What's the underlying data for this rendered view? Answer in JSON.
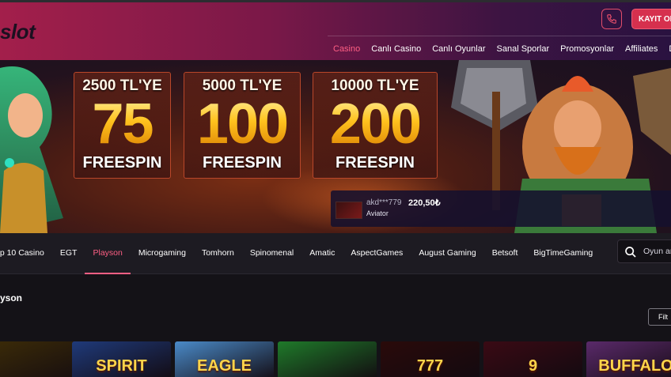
{
  "header": {
    "logo": "slot",
    "register_label": "KAYIT OL",
    "nav": [
      {
        "label": "Casino",
        "active": true
      },
      {
        "label": "Canlı Casino",
        "active": false
      },
      {
        "label": "Canlı Oyunlar",
        "active": false
      },
      {
        "label": "Sanal Sporlar",
        "active": false
      },
      {
        "label": "Promosyonlar",
        "active": false
      },
      {
        "label": "Affiliates",
        "active": false
      },
      {
        "label": "Discount",
        "active": false
      }
    ]
  },
  "banner": {
    "promos": [
      {
        "line1": "2500 TL'YE",
        "line2": "75",
        "line3": "FREESPIN"
      },
      {
        "line1": "5000 TL'YE",
        "line2": "100",
        "line3": "FREESPIN"
      },
      {
        "line1": "10000 TL'YE",
        "line2": "200",
        "line3": "FREESPIN"
      }
    ],
    "winner": {
      "user": "akd***779",
      "separator": "-",
      "amount": "220,50₺",
      "game": "Aviator"
    }
  },
  "providers": {
    "items": [
      {
        "label": "op 10 Casino",
        "active": false
      },
      {
        "label": "EGT",
        "active": false
      },
      {
        "label": "Playson",
        "active": true
      },
      {
        "label": "Microgaming",
        "active": false
      },
      {
        "label": "Tomhorn",
        "active": false
      },
      {
        "label": "Spinomenal",
        "active": false
      },
      {
        "label": "Amatic",
        "active": false
      },
      {
        "label": "AspectGames",
        "active": false
      },
      {
        "label": "August Gaming",
        "active": false
      },
      {
        "label": "Betsoft",
        "active": false
      },
      {
        "label": "BigTimeGaming",
        "active": false
      }
    ],
    "search_placeholder": "Oyun ar"
  },
  "section": {
    "title": "yson",
    "filter_label": "Filt"
  },
  "games": [
    {
      "label": "",
      "bg": "#3a2a08"
    },
    {
      "label": "SPIRIT",
      "bg": "#1f3a7a"
    },
    {
      "label": "EAGLE",
      "bg": "#4a8ac8"
    },
    {
      "label": "",
      "bg": "#1f7a2a"
    },
    {
      "label": "777",
      "bg": "#2a0a0a"
    },
    {
      "label": "9",
      "bg": "#3a0a14"
    },
    {
      "label": "BUFFALO",
      "bg": "#5a2a6a"
    }
  ],
  "colors": {
    "accent": "#ff5f84",
    "brand": "#a31f4b",
    "gold": "#ffc21e"
  }
}
